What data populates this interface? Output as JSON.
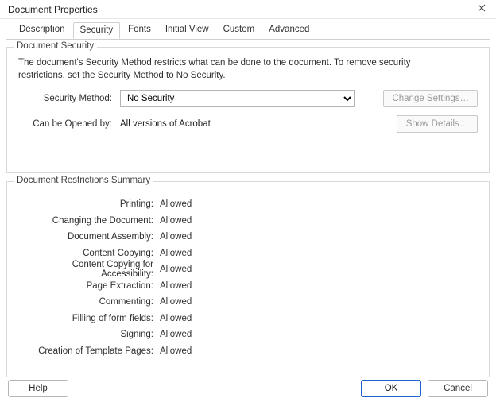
{
  "window": {
    "title": "Document Properties"
  },
  "tabs": [
    {
      "label": "Description"
    },
    {
      "label": "Security"
    },
    {
      "label": "Fonts"
    },
    {
      "label": "Initial View"
    },
    {
      "label": "Custom"
    },
    {
      "label": "Advanced"
    }
  ],
  "activeTabIndex": 1,
  "securityGroup": {
    "title": "Document Security",
    "intro": "The document's Security Method restricts what can be done to the document. To remove security restrictions, set the Security Method to No Security.",
    "method_label": "Security Method:",
    "method_value": "No Security",
    "change_settings_label": "Change Settings…",
    "opened_by_label": "Can be Opened by:",
    "opened_by_value": "All versions of Acrobat",
    "show_details_label": "Show Details…"
  },
  "restrictions": {
    "title": "Document Restrictions Summary",
    "items": [
      {
        "label": "Printing:",
        "value": "Allowed"
      },
      {
        "label": "Changing the Document:",
        "value": "Allowed"
      },
      {
        "label": "Document Assembly:",
        "value": "Allowed"
      },
      {
        "label": "Content Copying:",
        "value": "Allowed"
      },
      {
        "label": "Content Copying for Accessibility:",
        "value": "Allowed"
      },
      {
        "label": "Page Extraction:",
        "value": "Allowed"
      },
      {
        "label": "Commenting:",
        "value": "Allowed"
      },
      {
        "label": "Filling of form fields:",
        "value": "Allowed"
      },
      {
        "label": "Signing:",
        "value": "Allowed"
      },
      {
        "label": "Creation of Template Pages:",
        "value": "Allowed"
      }
    ]
  },
  "buttons": {
    "help": "Help",
    "ok": "OK",
    "cancel": "Cancel"
  }
}
